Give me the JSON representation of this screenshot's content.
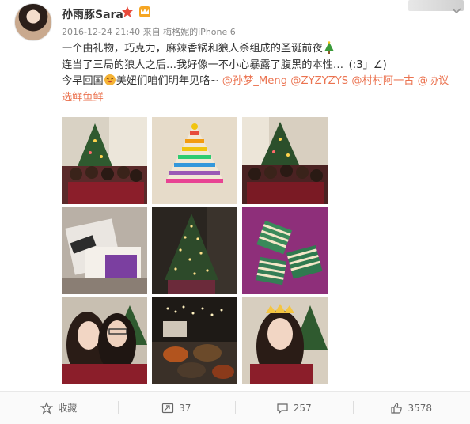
{
  "user": {
    "name": "孙雨豚Sara",
    "avatar_icon": "avatar",
    "badges": [
      "star-icon",
      "crown-icon"
    ]
  },
  "meta": {
    "timestamp": "2016-12-24 21:40",
    "source_prefix": "来自",
    "source": "梅格妮的iPhone 6"
  },
  "post": {
    "line1": "一个由礼物，巧克力，麻辣香锅和狼人杀组成的圣诞前夜",
    "line2": "连当了三局的狼人之后…我好像一不小心暴露了腹黑的本性…_(:3」∠)_",
    "line3_prefix": "今早回国",
    "line3_mid": "美妞们咱们明年见咯~",
    "mentions": [
      "@孙梦_Meng",
      "@ZYZYZYS",
      "@村村阿一古",
      "@协议选鲜鱼鲜"
    ]
  },
  "photos": [
    {
      "name": "photo-christmas-group-1"
    },
    {
      "name": "photo-chocolate-tree"
    },
    {
      "name": "photo-christmas-group-2"
    },
    {
      "name": "photo-gift-box"
    },
    {
      "name": "photo-christmas-tree"
    },
    {
      "name": "photo-wrapped-gifts"
    },
    {
      "name": "photo-selfie-two-girls"
    },
    {
      "name": "photo-hotpot-table"
    },
    {
      "name": "photo-crown-girl"
    }
  ],
  "actions": {
    "favorite_label": "收藏",
    "repost_count": "37",
    "comment_count": "257",
    "like_count": "3578"
  },
  "colors": {
    "mention": "#eb7350",
    "meta": "#888888",
    "text": "#333333"
  }
}
